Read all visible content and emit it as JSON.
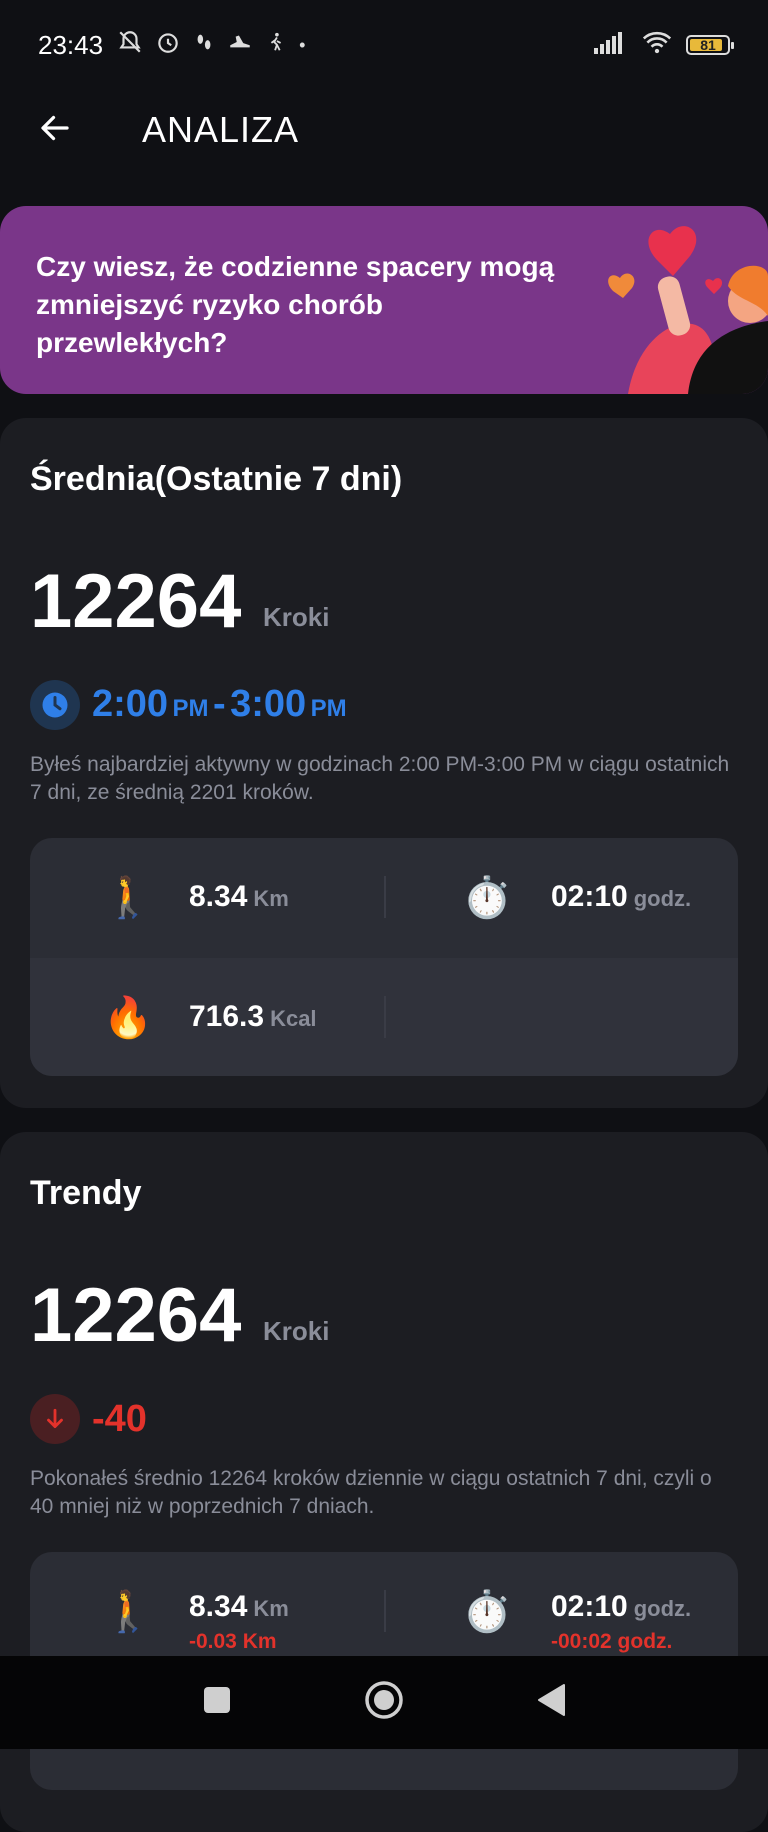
{
  "status_bar": {
    "time": "23:43",
    "battery_level": "81",
    "icons": [
      "bell-off-icon",
      "alarm-icon",
      "footsteps-icon",
      "shoe-icon",
      "walk-icon",
      "dot-icon",
      "signal-icon",
      "wifi-icon",
      "battery-icon"
    ]
  },
  "app_bar": {
    "title": "ANALIZA",
    "back_icon": "arrow-left-icon"
  },
  "banner": {
    "text": "Czy wiesz, że codzienne spacery mogą zmniejszyć ryzyko chorób przewlekłych?",
    "background": "#7a3689"
  },
  "average_card": {
    "title": "Średnia(Ostatnie 7 dni)",
    "steps": "12264",
    "steps_unit": "Kroki",
    "active_time": {
      "start": "2:00",
      "start_suffix": "PM",
      "separator": "-",
      "end": "3:00",
      "end_suffix": "PM"
    },
    "accent_color": "#2f7fe8",
    "description": "Byłeś najbardziej aktywny w godzinach 2:00 PM-3:00 PM w ciągu ostatnich 7 dni, ze średnią 2201 kroków.",
    "stats": {
      "distance": {
        "icon": "walking-person-icon",
        "value": "8.34",
        "unit": "Km"
      },
      "duration": {
        "icon": "stopwatch-icon",
        "value": "02:10",
        "unit": "godz."
      },
      "calories": {
        "icon": "fire-icon",
        "value": "716.3",
        "unit": "Kcal"
      }
    }
  },
  "trends_card": {
    "title": "Trendy",
    "steps": "12264",
    "steps_unit": "Kroki",
    "change": "-40",
    "change_color": "#e3322b",
    "description": "Pokonałeś średnio 12264 kroków dziennie w ciągu ostatnich 7 dni, czyli o 40 mniej niż w poprzednich 7 dniach.",
    "stats": {
      "distance": {
        "icon": "walking-person-icon",
        "value": "8.34",
        "unit": "Km",
        "change": "-0.03 Km"
      },
      "duration": {
        "icon": "stopwatch-icon",
        "value": "02:10",
        "unit": "godz.",
        "change": "-00:02 godz."
      }
    }
  },
  "nav_bar": {
    "buttons": [
      "recent-apps",
      "home",
      "back"
    ]
  }
}
